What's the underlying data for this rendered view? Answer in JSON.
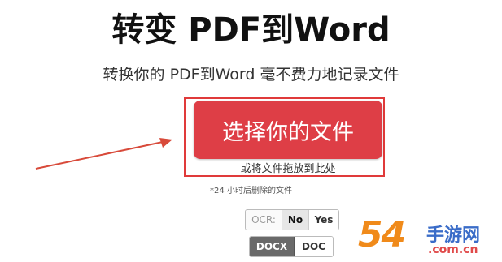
{
  "header": {
    "title": "转变 PDF到Word",
    "subtitle": "转换你的 PDF到Word 毫不费力地记录文件"
  },
  "upload": {
    "choose_label": "选择你的文件",
    "drop_hint": "或将文件拖放到此处",
    "delete_note": "*24 小时后删除的文件"
  },
  "ocr": {
    "label": "OCR:",
    "no_label": "No",
    "yes_label": "Yes",
    "selected": "No"
  },
  "format": {
    "options": [
      "DOCX",
      "DOC"
    ],
    "selected": "DOCX"
  },
  "watermark": {
    "number": "54",
    "text": "手游网",
    "site": ".com.cn"
  },
  "colors": {
    "primary_button": "#de3e46",
    "highlight": "#e03a3a",
    "selected_toggle": "#6a6a6a"
  }
}
